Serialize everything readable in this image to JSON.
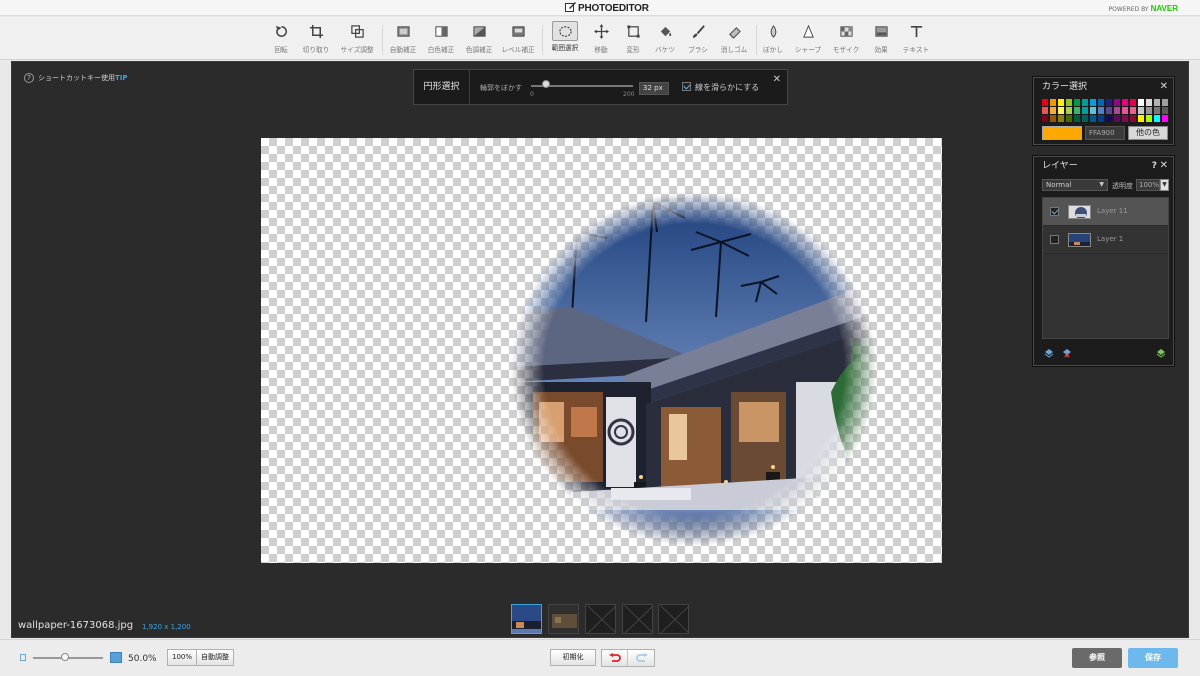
{
  "app": {
    "name": "PHOTOEDITOR",
    "powered_by": "POWERED BY",
    "brand": "NAVER"
  },
  "toolbar": {
    "tools": [
      {
        "id": "rotate",
        "label": "回転",
        "icon": "rotate-icon"
      },
      {
        "id": "crop",
        "label": "切り取り",
        "icon": "crop-icon"
      },
      {
        "id": "resize",
        "label": "サイズ調整",
        "icon": "resize-icon"
      },
      {
        "id": "auto",
        "label": "自動補正",
        "icon": "auto-correct-icon"
      },
      {
        "id": "white",
        "label": "白色補正",
        "icon": "white-balance-icon"
      },
      {
        "id": "hue",
        "label": "色調補正",
        "icon": "color-correct-icon"
      },
      {
        "id": "level",
        "label": "レベル補正",
        "icon": "level-icon"
      },
      {
        "id": "select",
        "label": "範囲選択",
        "icon": "ellipse-select-icon",
        "active": true
      },
      {
        "id": "move",
        "label": "移動",
        "icon": "move-icon"
      },
      {
        "id": "transform",
        "label": "変形",
        "icon": "transform-icon"
      },
      {
        "id": "bucket",
        "label": "バケツ",
        "icon": "bucket-icon"
      },
      {
        "id": "brush",
        "label": "ブラシ",
        "icon": "brush-icon"
      },
      {
        "id": "eraser",
        "label": "消しゴム",
        "icon": "eraser-icon"
      },
      {
        "id": "blur",
        "label": "ぼかし",
        "icon": "blur-icon"
      },
      {
        "id": "sharpen",
        "label": "シャープ",
        "icon": "sharpen-icon"
      },
      {
        "id": "mosaic",
        "label": "モザイク",
        "icon": "mosaic-icon"
      },
      {
        "id": "effect",
        "label": "効果",
        "icon": "effect-icon"
      },
      {
        "id": "text",
        "label": "テキスト",
        "icon": "text-icon"
      }
    ]
  },
  "tip": {
    "label": "ショートカットキー使用",
    "badge": "TIP"
  },
  "option_bar": {
    "title": "円形選択",
    "feather_label": "輪郭をぼかす",
    "slider_min": "0",
    "slider_max": "200",
    "slider_value": "32 px",
    "smooth_label": "線を滑らかにする",
    "smooth_checked": true
  },
  "color_panel": {
    "title": "カラー選択",
    "hex": "FFA900",
    "current_color": "#FFA900",
    "other_color_label": "他の色",
    "swatch_rows": [
      [
        "#e60012",
        "#f39800",
        "#fff100",
        "#8fc31f",
        "#009944",
        "#009e96",
        "#00a0e9",
        "#0068b7",
        "#1d2088",
        "#920783",
        "#e4007f",
        "#e5004f",
        "#ffffff",
        "#dcdcdc",
        "#b4b4b4",
        "#a0a0a0"
      ],
      [
        "#ea5550",
        "#f6ad3c",
        "#fff45c",
        "#aacf53",
        "#3eb370",
        "#00a0a0",
        "#59c3e1",
        "#4d83c4",
        "#5a4498",
        "#a64a97",
        "#e85298",
        "#ea618e",
        "#c8c8c8",
        "#969696",
        "#787878",
        "#5a5a5a"
      ],
      [
        "#7f0019",
        "#915a00",
        "#8c8200",
        "#486a00",
        "#005e3c",
        "#005f5f",
        "#005a8c",
        "#003f8e",
        "#140a5c",
        "#5a0a5a",
        "#820a50",
        "#8c0a32",
        "#ffee00",
        "#aaff00",
        "#00ffff",
        "#ff00ff"
      ]
    ]
  },
  "layer_panel": {
    "title": "レイヤー",
    "help": "?",
    "blend_mode": "Normal",
    "opacity_label": "透明度",
    "opacity_value": "100%",
    "layers": [
      {
        "name": "Layer 11",
        "checked": true,
        "selected": true
      },
      {
        "name": "Layer 1",
        "checked": false,
        "selected": false
      }
    ]
  },
  "file": {
    "name": "wallpaper-1673068.jpg",
    "size": "1,920 x 1,200"
  },
  "thumbnails": [
    "photo",
    "photo-dark",
    "empty",
    "empty",
    "empty"
  ],
  "status": {
    "zoom_value": "50.0%",
    "zoom_fraction": 0.5,
    "btn_100": "100%",
    "btn_auto": "自動調整",
    "btn_reset": "初期化",
    "btn_browse": "参照",
    "btn_save": "保存"
  },
  "colors": {
    "accent": "#3aa6e4",
    "save": "#6db8ec",
    "browse": "#6a6a6a",
    "workspace": "#2b2b2b",
    "naver_green": "#1ec800"
  }
}
